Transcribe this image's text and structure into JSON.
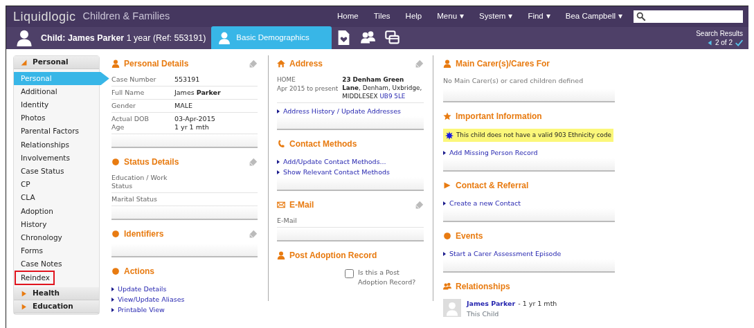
{
  "app": {
    "logo": "Liquidlogic",
    "title": "Children & Families"
  },
  "top_nav": [
    {
      "label": "Home",
      "dropdown": false
    },
    {
      "label": "Tiles",
      "dropdown": false
    },
    {
      "label": "Help",
      "dropdown": false
    },
    {
      "label": "Menu",
      "dropdown": true
    },
    {
      "label": "System",
      "dropdown": true
    },
    {
      "label": "Find",
      "dropdown": true
    },
    {
      "label": "Bea Campbell",
      "dropdown": true
    }
  ],
  "subject": "**Child: James Parker** 1 year (Ref: 553191)",
  "tabs": [
    {
      "kind": "person",
      "label": "Basic Demographics",
      "selected": true
    },
    {
      "kind": "document",
      "selected": false
    },
    {
      "kind": "people",
      "selected": false
    },
    {
      "kind": "windows",
      "selected": false
    }
  ],
  "search_results": {
    "title": "Search Results",
    "position": "2 of 2"
  },
  "sidebar": {
    "groups": [
      {
        "label": "Personal",
        "expanded": true,
        "items": [
          {
            "label": "Personal",
            "selected": true,
            "highlighted": false
          },
          {
            "label": "Additional",
            "selected": false,
            "highlighted": false
          },
          {
            "label": "Identity",
            "selected": false,
            "highlighted": false
          },
          {
            "label": "Photos",
            "selected": false,
            "highlighted": false
          },
          {
            "label": "Parental Factors",
            "selected": false,
            "highlighted": false
          },
          {
            "label": "Relationships",
            "selected": false,
            "highlighted": false
          },
          {
            "label": "Involvements",
            "selected": false,
            "highlighted": false
          },
          {
            "label": "Case Status",
            "selected": false,
            "highlighted": false
          },
          {
            "label": "CP",
            "selected": false,
            "highlighted": false
          },
          {
            "label": "CLA",
            "selected": false,
            "highlighted": false
          },
          {
            "label": "Adoption",
            "selected": false,
            "highlighted": false
          },
          {
            "label": "History",
            "selected": false,
            "highlighted": false
          },
          {
            "label": "Chronology",
            "selected": false,
            "highlighted": false
          },
          {
            "label": "Forms",
            "selected": false,
            "highlighted": false
          },
          {
            "label": "Case Notes",
            "selected": false,
            "highlighted": false
          },
          {
            "label": "Reindex",
            "selected": false,
            "highlighted": true
          }
        ]
      },
      {
        "label": "Health",
        "expanded": false
      },
      {
        "label": "Education",
        "expanded": false
      }
    ]
  },
  "columns": [
    [
      {
        "kind": "person",
        "title": "Personal Details",
        "editable": true,
        "rows": [
          [
            {
              "label": "Case Number",
              "value": "553191"
            }
          ],
          [
            {
              "label": "Full Name",
              "value": "James **Parker**"
            }
          ],
          [
            {
              "label": "Gender",
              "value": "MALE"
            }
          ],
          [
            {
              "label": "Actual DOB",
              "value": "03-Apr-2015"
            },
            {
              "label": "Age",
              "value": "1 yr 1 mth"
            }
          ]
        ]
      },
      {
        "kind": "dot",
        "title": "Status Details",
        "editable": true,
        "rows": [
          [
            {
              "label": "Education / Work Status"
            }
          ],
          [
            {
              "label": "Marital Status"
            }
          ]
        ]
      },
      {
        "kind": "dot",
        "title": "Identifiers",
        "editable": true
      },
      {
        "kind": "dot",
        "title": "Actions",
        "editable": false,
        "links": [
          "Update Details",
          "View/Update Aliases",
          "Printable View"
        ]
      }
    ],
    [
      {
        "kind": "home",
        "title": "Address",
        "editable": true,
        "address": {
          "type": "HOME",
          "period": "Apr 2015 to present",
          "value": "**23 Denham Green Lane**, Denham, Uxbridge, MIDDLESEX",
          "postcode": "UB9 5LE"
        },
        "links": [
          "Address History / Update Addresses"
        ]
      },
      {
        "kind": "phone",
        "title": "Contact Methods",
        "editable": false,
        "links": [
          "Add/Update Contact Methods...",
          "Show Relevant Contact Methods"
        ]
      },
      {
        "kind": "envelope",
        "title": "E-Mail",
        "editable": true,
        "rows": [
          [
            {
              "label": "E-Mail"
            }
          ]
        ]
      },
      {
        "kind": "person",
        "title": "Post Adoption Record",
        "editable": false,
        "checkbox": {
          "label": "Is this a Post Adoption Record?",
          "checked": false
        }
      }
    ],
    [
      {
        "kind": "person",
        "title": "Main Carer(s)/Cares For",
        "editable": false,
        "note": "No Main Carer(s) or cared children defined"
      },
      {
        "kind": "star",
        "title": "Important Information",
        "editable": false,
        "alert": "This child does not have a valid 903 Ethnicity code",
        "links": [
          "Add Missing Person Record"
        ]
      },
      {
        "kind": "triangle",
        "title": "Contact & Referral",
        "editable": false,
        "links": [
          "Create a new Contact"
        ]
      },
      {
        "kind": "dot",
        "title": "Events",
        "editable": false,
        "links": [
          "Start a Carer Assessment Episode"
        ]
      },
      {
        "kind": "people",
        "title": "Relationships",
        "editable": false,
        "people": [
          {
            "name": "James Parker",
            "detail": "- 1 yr 1 mth",
            "relation": "This Child"
          }
        ]
      }
    ]
  ]
}
